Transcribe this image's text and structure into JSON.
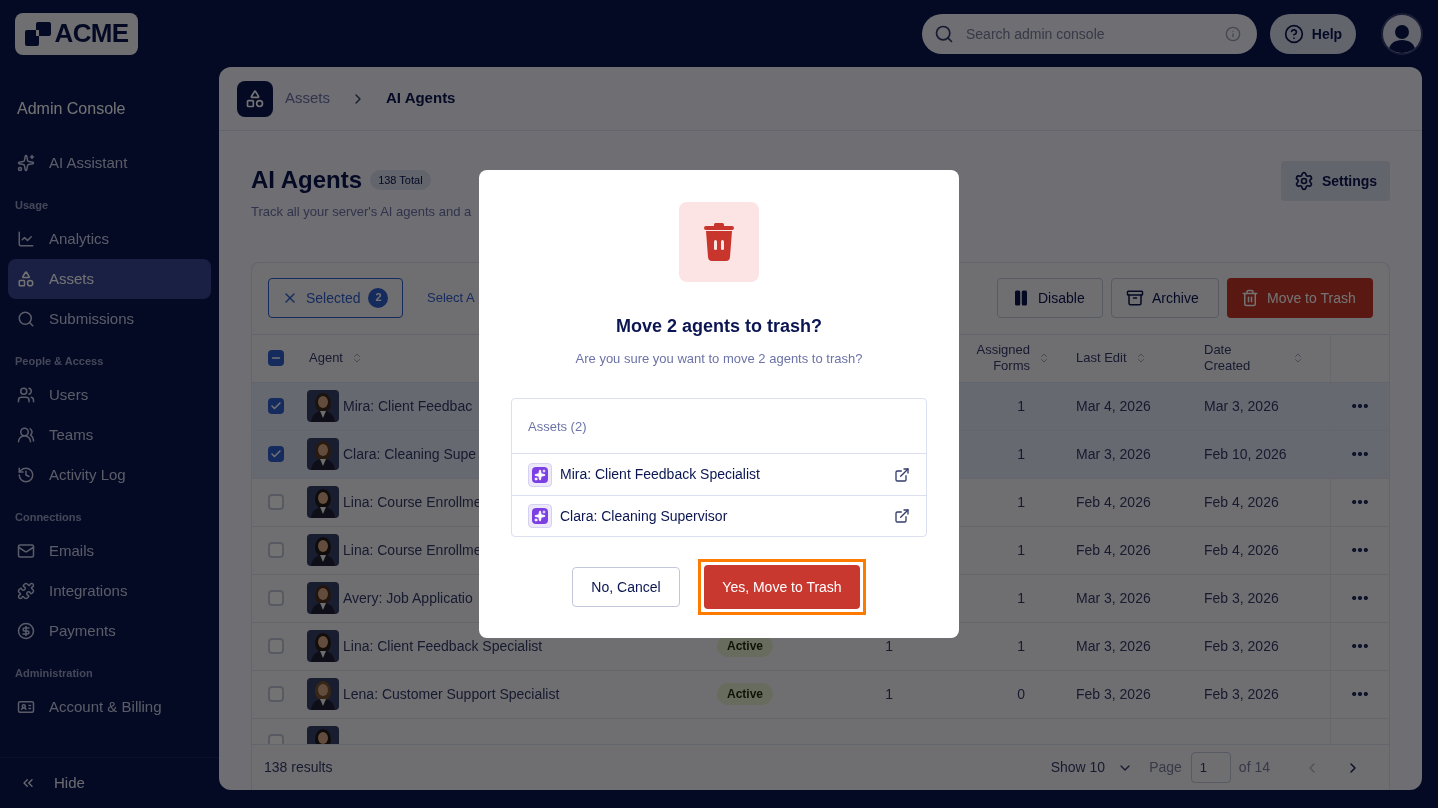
{
  "top_bar": {
    "logo": "ACME",
    "search": {
      "placeholder": "Search admin console"
    },
    "help": "Help"
  },
  "sidebar": {
    "title": "Admin Console",
    "sections": [
      {
        "items": [
          {
            "label": "AI Assistant",
            "selected": false
          }
        ]
      },
      {
        "heading": "Usage",
        "items": [
          {
            "label": "Analytics",
            "selected": false
          },
          {
            "label": "Assets",
            "selected": true
          },
          {
            "label": "Submissions",
            "selected": false
          }
        ]
      },
      {
        "heading": "People & Access",
        "items": [
          {
            "label": "Users",
            "selected": false
          },
          {
            "label": "Teams",
            "selected": false
          },
          {
            "label": "Activity Log",
            "selected": false
          }
        ]
      },
      {
        "heading": "Connections",
        "items": [
          {
            "label": "Emails",
            "selected": false
          },
          {
            "label": "Integrations",
            "selected": false
          },
          {
            "label": "Payments",
            "selected": false
          }
        ]
      },
      {
        "heading": "Administration",
        "items": [
          {
            "label": "Account & Billing",
            "selected": false
          }
        ]
      }
    ],
    "hide": "Hide"
  },
  "breadcrumb": [
    "Assets",
    "AI Agents"
  ],
  "page": {
    "title": "AI Agents",
    "total": "138 Total",
    "subtitle": "Track all your server's AI agents and a",
    "settings": "Settings"
  },
  "toolbar": {
    "selected": {
      "label": "Selected",
      "count": "2"
    },
    "select_all": "Select A",
    "actions": [
      {
        "label": "Disable",
        "kind": "pause"
      },
      {
        "label": "Archive",
        "kind": "archive"
      },
      {
        "label": "Move to Trash",
        "kind": "trash"
      }
    ]
  },
  "table": {
    "header_checkbox": {
      "indeterminate": true
    },
    "columns": {
      "agent": "Agent",
      "assigned_forms": "Assigned Forms",
      "last_edit": "Last Edit",
      "date_created": "Date Created"
    },
    "rows": [
      {
        "selected": true,
        "agent": "Mira: Client Feedbac",
        "assigned_forms": "1",
        "last_edit": "Mar 4, 2026",
        "date_created": "Mar 3, 2026"
      },
      {
        "selected": true,
        "agent": "Clara: Cleaning Supe",
        "assigned_forms": "1",
        "last_edit": "Mar 3, 2026",
        "date_created": "Feb 10, 2026"
      },
      {
        "selected": false,
        "agent": "Lina: Course Enrollme",
        "assigned_forms": "1",
        "last_edit": "Feb 4, 2026",
        "date_created": "Feb 4, 2026"
      },
      {
        "selected": false,
        "agent": "Lina: Course Enrollme",
        "assigned_forms": "1",
        "last_edit": "Feb 4, 2026",
        "date_created": "Feb 4, 2026"
      },
      {
        "selected": false,
        "agent": "Avery: Job Applicatio",
        "assigned_forms": "1",
        "last_edit": "Mar 3, 2026",
        "date_created": "Feb 3, 2026"
      },
      {
        "selected": false,
        "agent": "Lina: Client Feedback Specialist",
        "status": "Active",
        "column_3": "1",
        "assigned_forms": "1",
        "last_edit": "Mar 3, 2026",
        "date_created": "Feb 3, 2026"
      },
      {
        "selected": false,
        "agent": "Lena: Customer Support Specialist",
        "status": "Active",
        "column_3": "1",
        "assigned_forms": "0",
        "last_edit": "Feb 3, 2026",
        "date_created": "Feb 3, 2026"
      },
      {
        "selected": false
      }
    ],
    "footer": {
      "results": "138 results",
      "show": "Show 10",
      "page_label": "Page",
      "page": "1",
      "of": "of 14"
    }
  },
  "modal": {
    "title": "Move 2 agents to trash?",
    "message": "Are you sure you want to move 2 agents to trash?",
    "list_heading": "Assets (2)",
    "items": [
      "Mira: Client Feedback Specialist",
      "Clara: Cleaning Supervisor"
    ],
    "buttons": [
      {
        "label": "No, Cancel",
        "kind": "secondary",
        "focused": false
      },
      {
        "label": "Yes, Move to Trash",
        "kind": "danger",
        "focused": true
      }
    ]
  }
}
